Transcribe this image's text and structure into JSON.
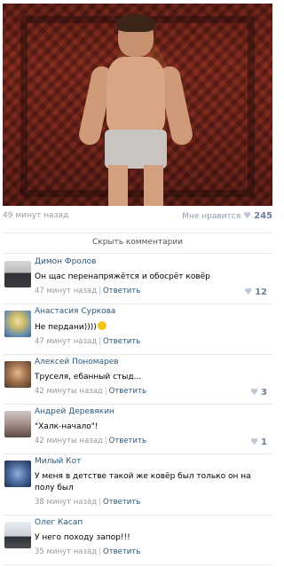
{
  "post": {
    "time": "49 минут назад",
    "like_label": "Мне нравится",
    "like_count": "245",
    "hide_comments": "Скрыть комментарии"
  },
  "comments": [
    {
      "name": "Димон Фролов",
      "text": "Он щас перенапряжётся и обосрёт ковёр",
      "time": "47 минут назад",
      "reply": "Ответить",
      "likes": "12"
    },
    {
      "name": "Анастасия Суркова",
      "text": "Не пердани))))",
      "time": "47 минут назад",
      "reply": "Ответить",
      "likes": ""
    },
    {
      "name": "Алексей Пономарев",
      "text": "Труселя, ебанный стыд...",
      "time": "42 минуты назад",
      "reply": "Ответить",
      "likes": "3"
    },
    {
      "name": "Андрей Деревякин",
      "text": "\"Халк-начало\"!",
      "time": "42 минуты назад",
      "reply": "Ответить",
      "likes": "1"
    },
    {
      "name": "Милый Кот",
      "text": "У меня в детстве такой же ковёр был только он на полу был",
      "time": "38 минут назад",
      "reply": "Ответить",
      "likes": ""
    },
    {
      "name": "Олег Касап",
      "text": "У него походу запор!!!",
      "time": "35 минут назад",
      "reply": "Ответить",
      "likes": ""
    }
  ],
  "colors": {
    "link": "#2b587a",
    "meta": "#999999",
    "like_count": "#6b7f99",
    "divider": "#e6e9ee"
  },
  "icons": {
    "like": "heart-icon",
    "emoji": "laughing-emoji-icon"
  }
}
